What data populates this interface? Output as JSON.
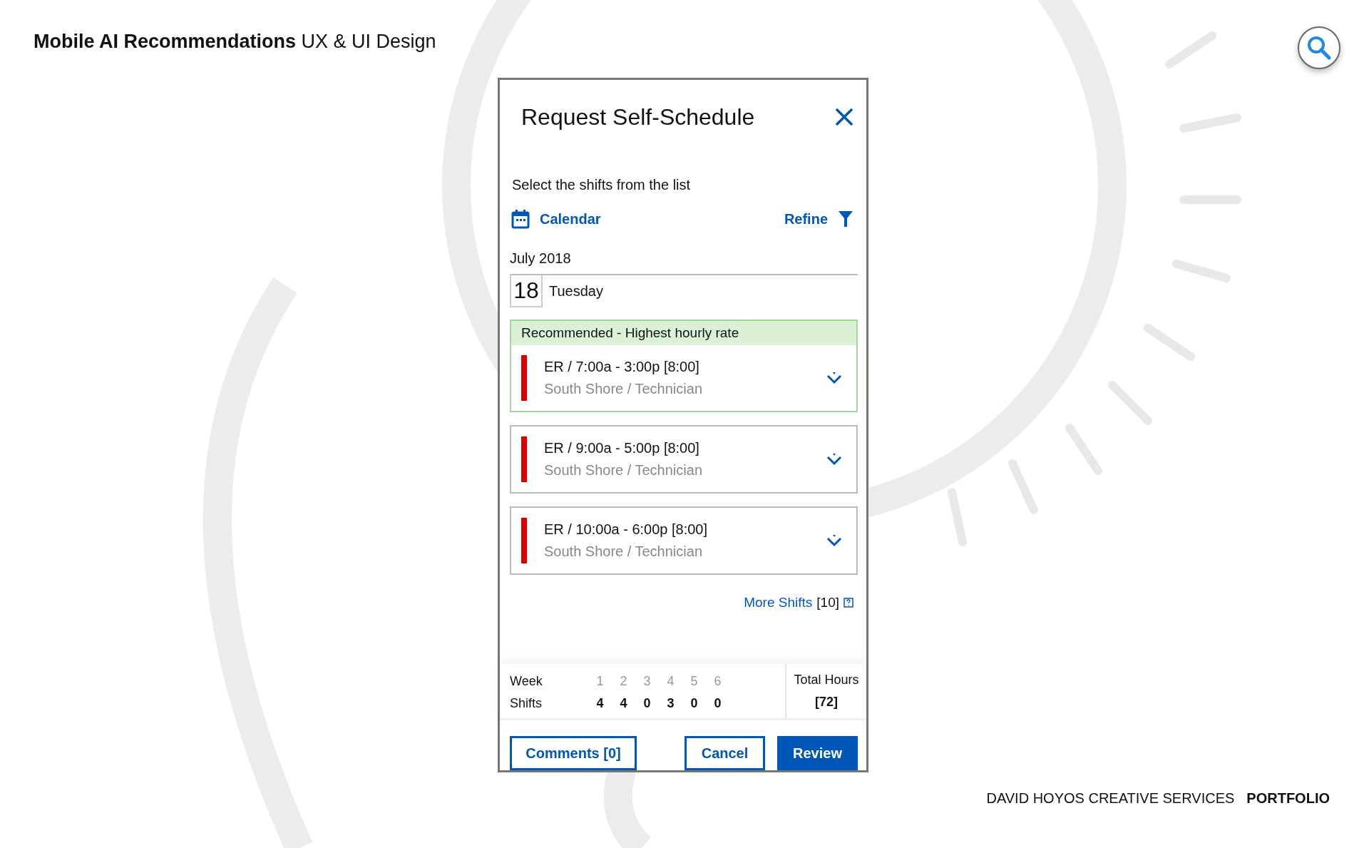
{
  "header": {
    "title_bold": "Mobile AI Recommendations",
    "title_rest": "UX & UI Design"
  },
  "dialog": {
    "title": "Request Self-Schedule",
    "instruction": "Select the shifts from the list",
    "calendar_link": "Calendar",
    "refine_link": "Refine",
    "month": "July 2018",
    "day_number": "18",
    "weekday": "Tuesday",
    "shifts": [
      {
        "recommended": true,
        "recommendation": "Recommended - Highest hourly rate",
        "time": "ER / 7:00a - 3:00p [8:00]",
        "place": "South Shore / Technician"
      },
      {
        "recommended": false,
        "time": "ER / 9:00a - 5:00p [8:00]",
        "place": "South Shore / Technician"
      },
      {
        "recommended": false,
        "time": "ER / 10:00a - 6:00p [8:00]",
        "place": "South Shore / Technician"
      }
    ],
    "more_shifts": {
      "label": "More Shifts",
      "count": "[10]"
    },
    "summary": {
      "week_label": "Week",
      "shifts_label": "Shifts",
      "weeks": [
        {
          "week": "1",
          "shifts": "4"
        },
        {
          "week": "2",
          "shifts": "4"
        },
        {
          "week": "3",
          "shifts": "0"
        },
        {
          "week": "4",
          "shifts": "3"
        },
        {
          "week": "5",
          "shifts": "0"
        },
        {
          "week": "6",
          "shifts": "0"
        }
      ],
      "total_label": "Total Hours",
      "total_value": "[72]"
    },
    "buttons": {
      "comments": "Comments [0]",
      "cancel": "Cancel",
      "review": "Review"
    }
  },
  "footer": {
    "studio": "DAVID HOYOS CREATIVE SERVICES",
    "section": "PORTFOLIO"
  }
}
